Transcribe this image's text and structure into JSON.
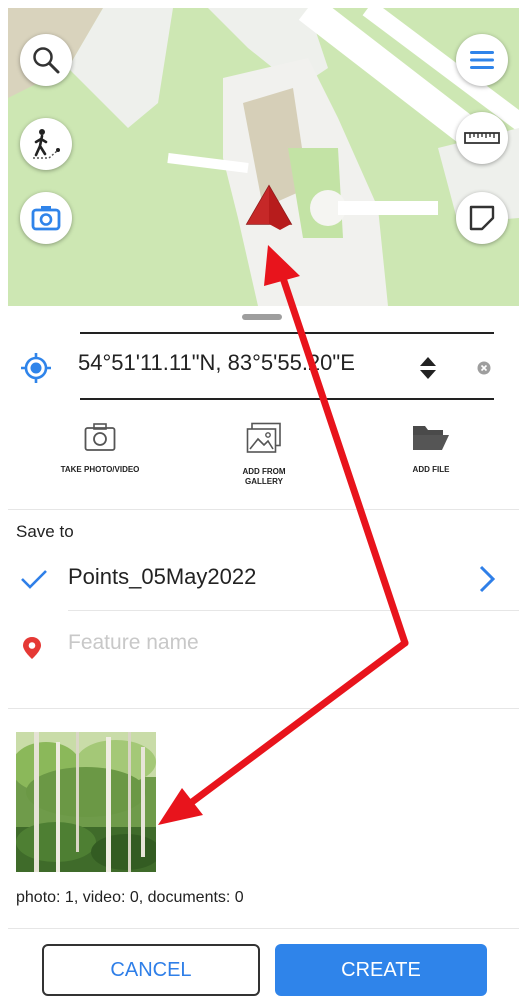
{
  "map": {
    "buttons": [
      {
        "name": "search",
        "icon": "search-icon"
      },
      {
        "name": "route",
        "icon": "walker-route-icon"
      },
      {
        "name": "camera",
        "icon": "camera-icon"
      },
      {
        "name": "menu",
        "icon": "menu-icon"
      },
      {
        "name": "measure",
        "icon": "ruler-icon"
      },
      {
        "name": "area",
        "icon": "polygon-icon"
      }
    ]
  },
  "location": {
    "coordinates": "54°51'11.11\"N, 83°5'55.20\"E",
    "icon": "location-target-icon"
  },
  "actions": {
    "take_photo": "TAKE PHOTO/VIDEO",
    "gallery_line1": "ADD FROM",
    "gallery_line2": "GALLERY",
    "add_file": "ADD FILE"
  },
  "save_to": {
    "label": "Save to",
    "layer": "Points_05May2022"
  },
  "feature": {
    "placeholder": "Feature name"
  },
  "attachments": {
    "counts": "photo: 1, video: 0, documents: 0"
  },
  "buttons": {
    "cancel": "CANCEL",
    "create": "CREATE"
  },
  "colors": {
    "accent": "#2f84ea",
    "marker": "#e53935",
    "arrow": "#e8141c"
  }
}
